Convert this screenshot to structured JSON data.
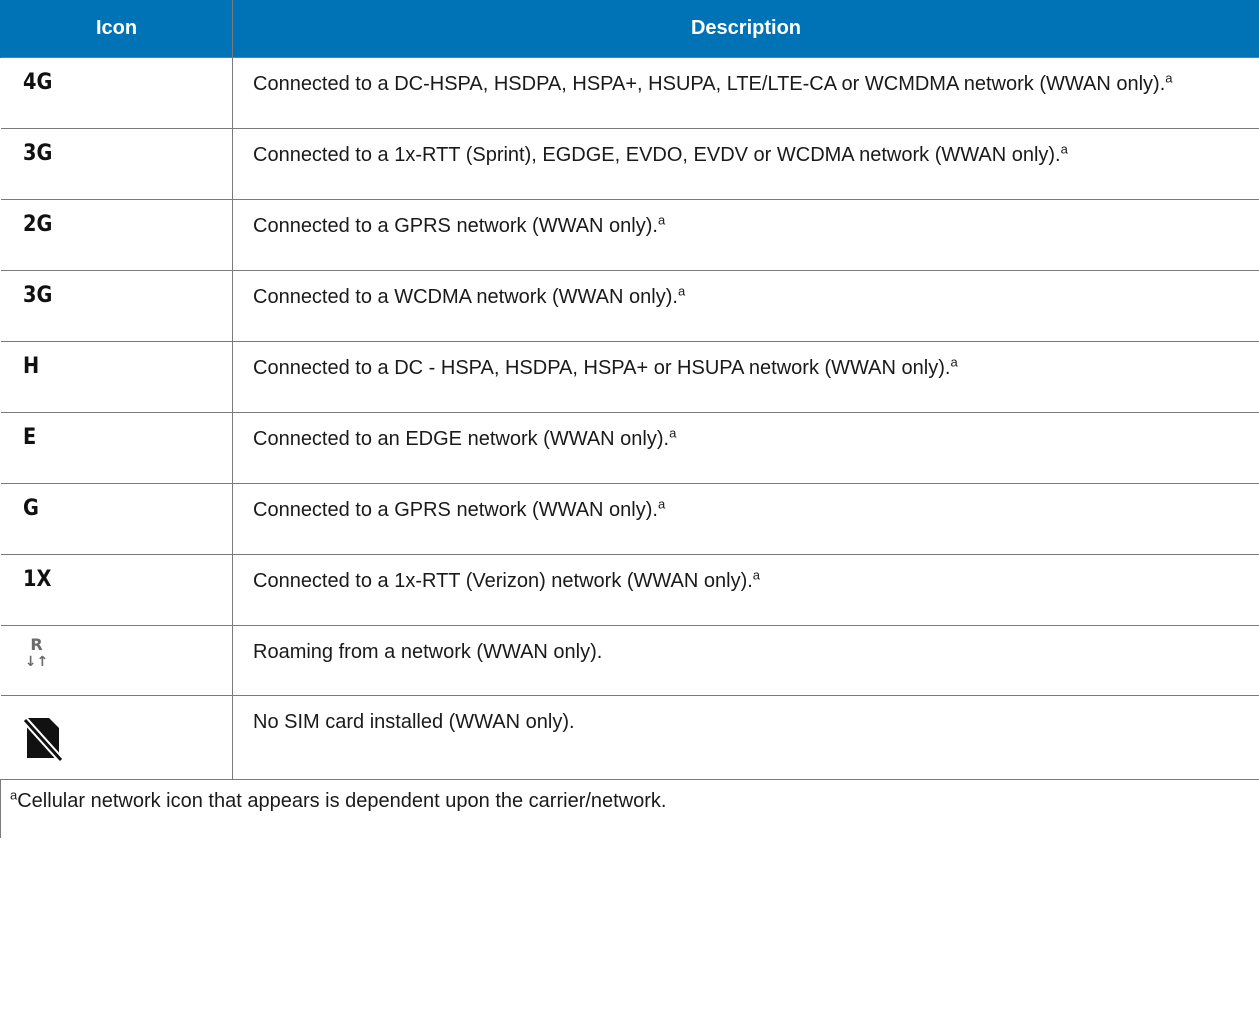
{
  "header": {
    "icon_col": "Icon",
    "description_col": "Description"
  },
  "rows": [
    {
      "icon": "4G",
      "icon_name": "4g-network-icon",
      "description": "Connected to a DC-HSPA, HSDPA, HSPA+, HSUPA, LTE/LTE-CA or WCMDMA network (WWAN only).",
      "sup": "a"
    },
    {
      "icon": "3G",
      "icon_name": "3g-network-icon",
      "description": "Connected to a 1x-RTT (Sprint), EGDGE, EVDO, EVDV or WCDMA network (WWAN only).",
      "sup": "a"
    },
    {
      "icon": "2G",
      "icon_name": "2g-network-icon",
      "description": "Connected to a GPRS network (WWAN only).",
      "sup": "a"
    },
    {
      "icon": "3G",
      "icon_name": "3g-network-icon",
      "description": "Connected to a WCDMA network (WWAN only).",
      "sup": "a"
    },
    {
      "icon": "H",
      "icon_name": "h-network-icon",
      "description": "Connected to a DC - HSPA, HSDPA, HSPA+ or HSUPA network (WWAN only).",
      "sup": "a"
    },
    {
      "icon": "E",
      "icon_name": "edge-network-icon",
      "description": "Connected to an EDGE network (WWAN only).",
      "sup": "a"
    },
    {
      "icon": "G",
      "icon_name": "gprs-network-icon",
      "description": "Connected to a GPRS network (WWAN only).",
      "sup": "a"
    },
    {
      "icon": "1X",
      "icon_name": "1x-network-icon",
      "description": "Connected to a 1x-RTT (Verizon) network (WWAN only).",
      "sup": "a"
    },
    {
      "icon": "R",
      "icon_arrows": "↓↑",
      "icon_name": "roaming-icon",
      "description": "Roaming from a network (WWAN only).",
      "sup": ""
    },
    {
      "icon": "",
      "icon_name": "no-sim-icon",
      "description": "No SIM card installed (WWAN only).",
      "sup": ""
    }
  ],
  "footnote": {
    "marker": "a",
    "text": "Cellular network icon that appears is dependent upon the carrier/network."
  }
}
